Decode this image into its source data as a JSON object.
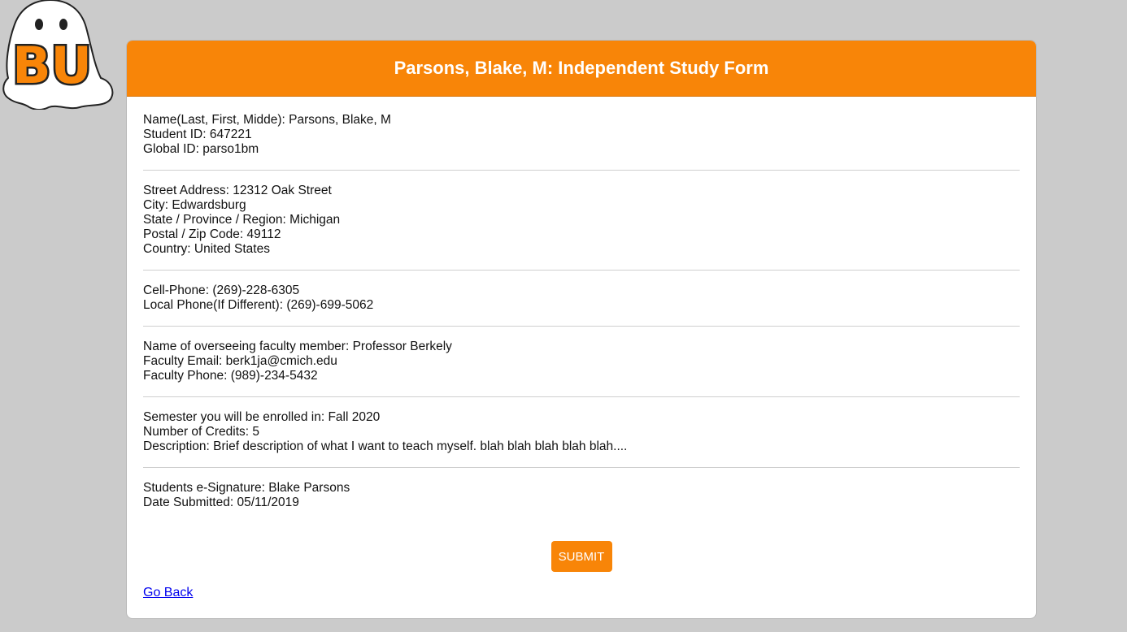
{
  "logo": {
    "text": "BU",
    "icon": "ghost-logo"
  },
  "header": {
    "title": "Parsons, Blake, M: Independent Study Form"
  },
  "sections": [
    {
      "rows": [
        {
          "label": "Name(Last, First, Midde)",
          "value": "Parsons, Blake, M"
        },
        {
          "label": "Student ID",
          "value": "647221"
        },
        {
          "label": "Global ID",
          "value": "parso1bm"
        }
      ]
    },
    {
      "rows": [
        {
          "label": "Street Address",
          "value": "12312 Oak Street"
        },
        {
          "label": "City",
          "value": "Edwardsburg"
        },
        {
          "label": "State / Province / Region",
          "value": "Michigan"
        },
        {
          "label": "Postal / Zip Code",
          "value": "49112"
        },
        {
          "label": "Country",
          "value": "United States"
        }
      ]
    },
    {
      "rows": [
        {
          "label": "Cell-Phone",
          "value": "(269)-228-6305"
        },
        {
          "label": "Local Phone(If Different)",
          "value": "(269)-699-5062"
        }
      ]
    },
    {
      "rows": [
        {
          "label": "Name of overseeing faculty member",
          "value": "Professor Berkely"
        },
        {
          "label": "Faculty Email",
          "value": "berk1ja@cmich.edu"
        },
        {
          "label": "Faculty Phone",
          "value": "(989)-234-5432"
        }
      ]
    },
    {
      "rows": [
        {
          "label": "Semester you will be enrolled in",
          "value": "Fall 2020"
        },
        {
          "label": "Number of Credits",
          "value": "5"
        },
        {
          "label": "Description",
          "value": "Brief description of what I want to teach myself. blah blah blah blah blah...."
        }
      ]
    },
    {
      "rows": [
        {
          "label": "Students e-Signature",
          "value": "Blake Parsons"
        },
        {
          "label": "Date Submitted",
          "value": "05/11/2019"
        }
      ]
    }
  ],
  "actions": {
    "submit_label": "SUBMIT",
    "back_label": "Go Back"
  },
  "colors": {
    "accent": "#f88508",
    "page_bg": "#cbcbcb",
    "link": "#0000ee"
  }
}
